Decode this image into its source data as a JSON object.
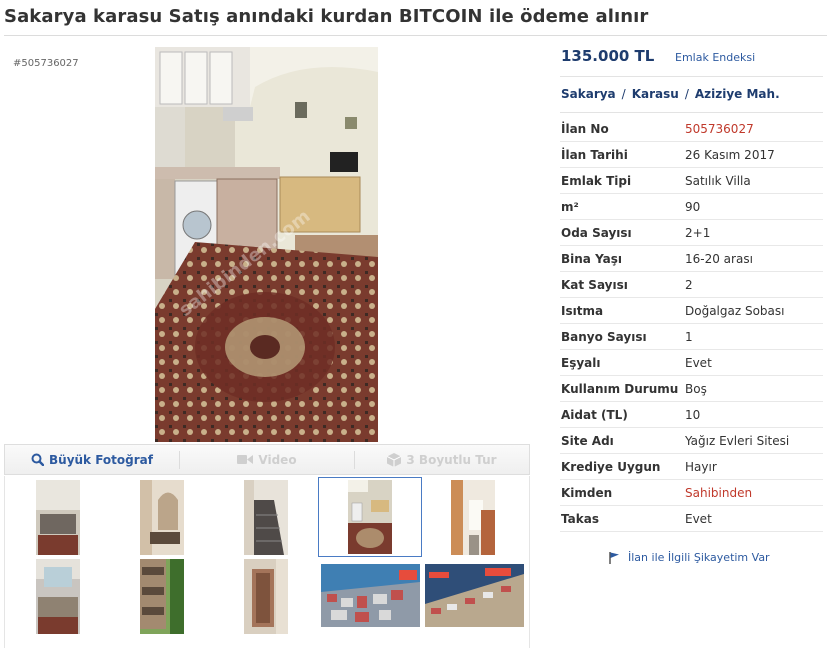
{
  "title": "Sakarya karasu Satış anındaki kurdan BITCOIN ile ödeme alınır",
  "listing_id_label": "#505736027",
  "price": "135.000 TL",
  "price_index_link": "Emlak Endeksi",
  "breadcrumb": [
    "Sakarya",
    "Karasu",
    "Aziziye Mah."
  ],
  "breadcrumb_separator": "/",
  "details": [
    {
      "label": "İlan No",
      "value": "505736027",
      "highlight": true
    },
    {
      "label": "İlan Tarihi",
      "value": "26 Kasım 2017",
      "highlight": false
    },
    {
      "label": "Emlak Tipi",
      "value": "Satılık Villa",
      "highlight": false
    },
    {
      "label": "m²",
      "value": "90",
      "highlight": false
    },
    {
      "label": "Oda Sayısı",
      "value": "2+1",
      "highlight": false
    },
    {
      "label": "Bina Yaşı",
      "value": "16-20 arası",
      "highlight": false
    },
    {
      "label": "Kat Sayısı",
      "value": "2",
      "highlight": false
    },
    {
      "label": "Isıtma",
      "value": "Doğalgaz Sobası",
      "highlight": false
    },
    {
      "label": "Banyo Sayısı",
      "value": "1",
      "highlight": false
    },
    {
      "label": "Eşyalı",
      "value": "Evet",
      "highlight": false
    },
    {
      "label": "Kullanım Durumu",
      "value": "Boş",
      "highlight": false
    },
    {
      "label": "Aidat (TL)",
      "value": "10",
      "highlight": false
    },
    {
      "label": "Site Adı",
      "value": "Yağız Evleri Sitesi",
      "highlight": false
    },
    {
      "label": "Krediye Uygun",
      "value": "Hayır",
      "highlight": false
    },
    {
      "label": "Kimden",
      "value": "Sahibinden",
      "highlight": true
    },
    {
      "label": "Takas",
      "value": "Evet",
      "highlight": false
    }
  ],
  "toolbar": {
    "large_photo": "Büyük Fotoğraf",
    "video": "Video",
    "tour": "3 Boyutlu Tur"
  },
  "complaint_link": "İlan ile İlgili Şikayetim Var",
  "watermark": "sahibinden.com",
  "colors": {
    "brand_blue": "#1e3c6e",
    "link_blue": "#2d5aa0",
    "highlight_red": "#c0392b"
  },
  "icons": {
    "large_photo": "magnifier-icon",
    "video": "video-camera-icon",
    "tour": "cube-icon",
    "complaint": "flag-icon"
  }
}
